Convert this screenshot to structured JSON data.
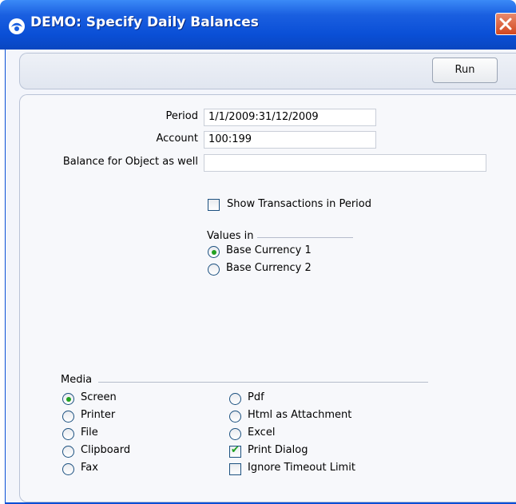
{
  "window": {
    "title": "DEMO: Specify Daily Balances"
  },
  "toolbar": {
    "run_label": "Run"
  },
  "form": {
    "period_label": "Period",
    "period_value": "1/1/2009:31/12/2009",
    "account_label": "Account",
    "account_value": "100:199",
    "balance_object_label": "Balance for Object as well",
    "balance_object_value": "",
    "show_transactions_label": "Show Transactions in Period",
    "show_transactions_checked": false
  },
  "values_in": {
    "heading": "Values in",
    "options": [
      {
        "label": "Base Currency 1",
        "selected": true
      },
      {
        "label": "Base Currency 2",
        "selected": false
      }
    ]
  },
  "media": {
    "heading": "Media",
    "left_options": [
      {
        "label": "Screen",
        "selected": true
      },
      {
        "label": "Printer",
        "selected": false
      },
      {
        "label": "File",
        "selected": false
      },
      {
        "label": "Clipboard",
        "selected": false
      },
      {
        "label": "Fax",
        "selected": false
      }
    ],
    "right_options": [
      {
        "label": "Pdf",
        "selected": false
      },
      {
        "label": "Html as Attachment",
        "selected": false
      },
      {
        "label": "Excel",
        "selected": false
      }
    ],
    "print_dialog_label": "Print Dialog",
    "print_dialog_checked": true,
    "ignore_timeout_label": "Ignore Timeout Limit",
    "ignore_timeout_checked": false
  },
  "colors": {
    "titlebar": "#0a4fd6",
    "accent_green": "#21a121",
    "close": "#d2471f"
  }
}
